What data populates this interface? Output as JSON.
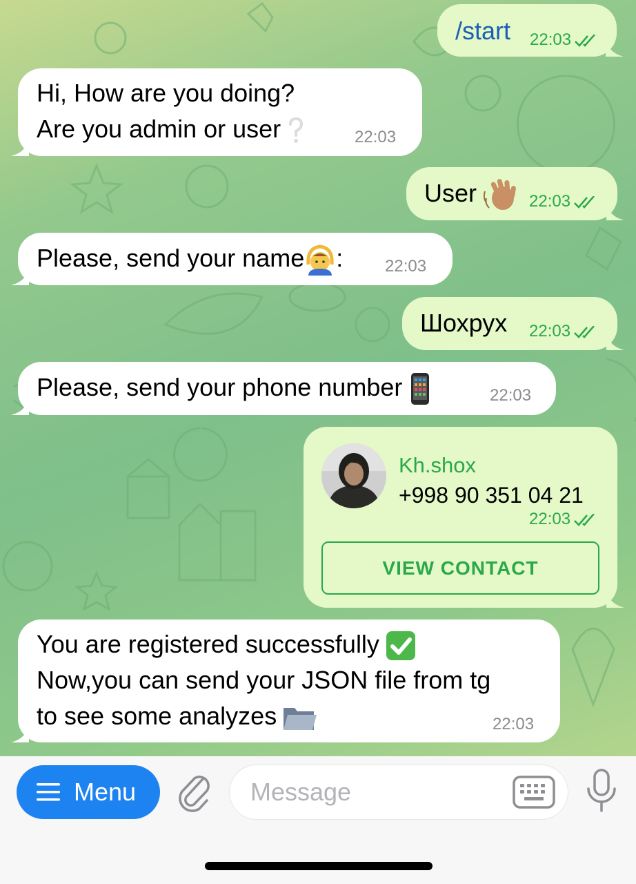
{
  "messages": [
    {
      "side": "out",
      "text": "/start",
      "time": "22:03"
    },
    {
      "side": "in",
      "line1": "Hi, How are you doing?",
      "line2": "Are you admin or user",
      "time": "22:03"
    },
    {
      "side": "out",
      "text": "User",
      "time": "22:03"
    },
    {
      "side": "in",
      "text": "Please, send your name",
      "suffix": ":",
      "time": "22:03"
    },
    {
      "side": "out",
      "text": "Шохрух",
      "time": "22:03"
    },
    {
      "side": "in",
      "text": "Please, send your phone number",
      "time": "22:03"
    },
    {
      "side": "out",
      "type": "contact",
      "name": "Kh.shox",
      "phone": "+998 90 351 04 21",
      "time": "22:03",
      "button": "VIEW CONTACT"
    },
    {
      "side": "in",
      "line1": "You are registered successfully",
      "line2": "Now,you can send your JSON file from tg",
      "line3": "to see some analyzes",
      "time": "22:03"
    }
  ],
  "composer": {
    "menu_label": "Menu",
    "placeholder": "Message"
  },
  "icons": {
    "menu": "hamburger-icon",
    "attach": "paperclip-icon",
    "keyboard": "keyboard-icon",
    "mic": "microphone-icon",
    "read": "double-check-icon"
  },
  "colors": {
    "outgoing_bubble": "#e4f8c8",
    "incoming_bubble": "#ffffff",
    "accent_green": "#2aa84a",
    "menu_blue": "#1d83f0",
    "command_blue": "#1a5fb4"
  }
}
